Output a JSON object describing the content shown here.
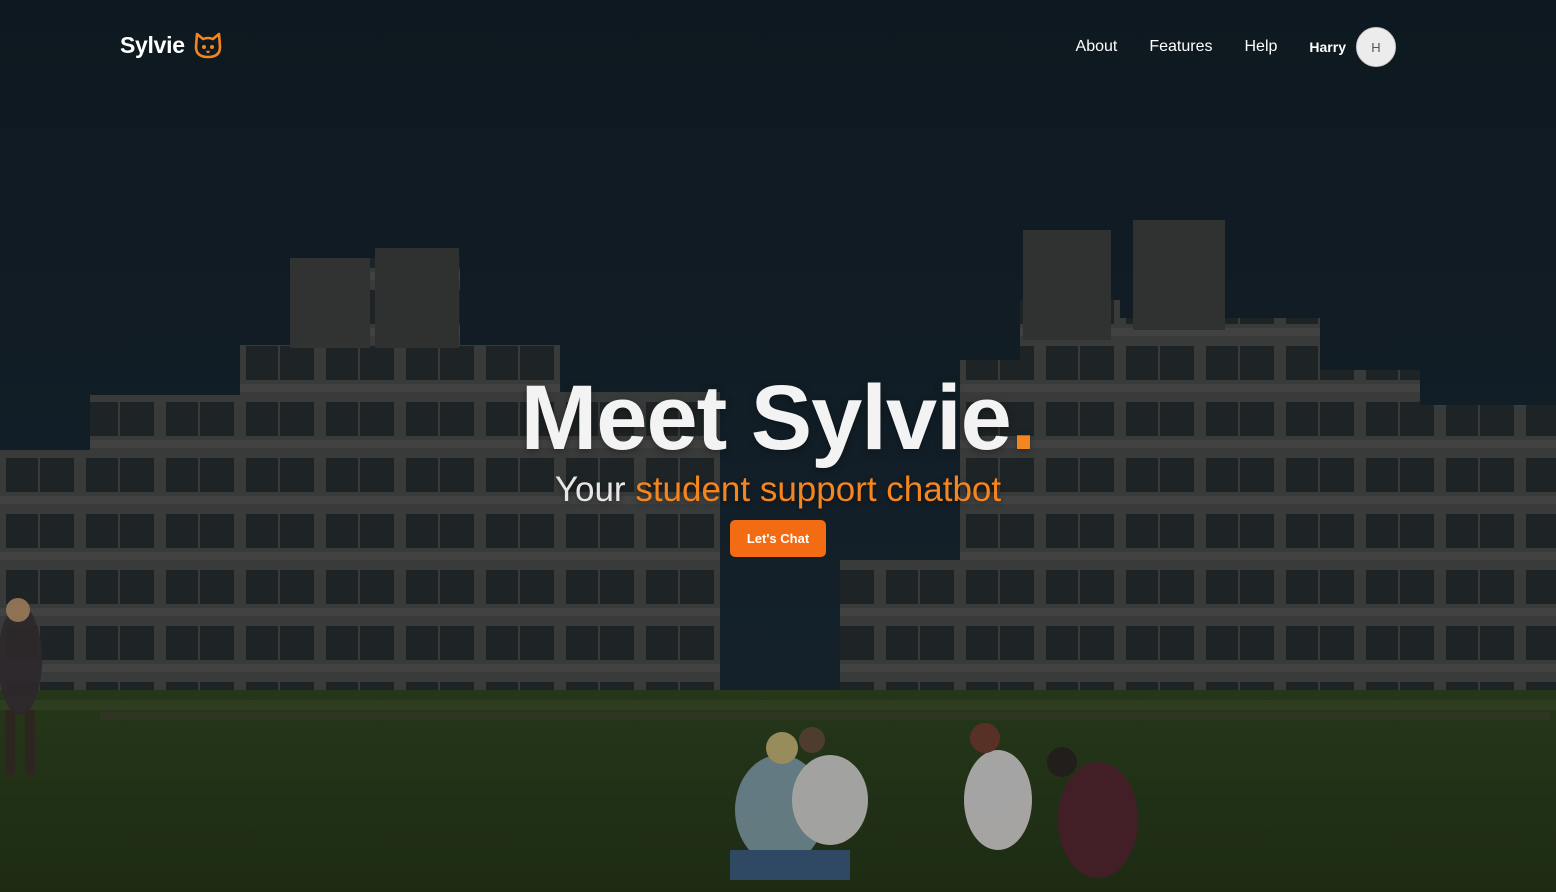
{
  "brand": {
    "name": "Sylvie"
  },
  "nav": {
    "links": [
      "About",
      "Features",
      "Help"
    ],
    "user_name": "Harry",
    "avatar_initial": "H"
  },
  "hero": {
    "title": "Meet Sylvie",
    "title_dot": ".",
    "subtitle_prefix": "Your ",
    "subtitle_accent": "student support chatbot",
    "cta_label": "Let's Chat"
  },
  "colors": {
    "accent": "#f5851f",
    "cta": "#f36b12",
    "overlay": "#0f1a22"
  }
}
